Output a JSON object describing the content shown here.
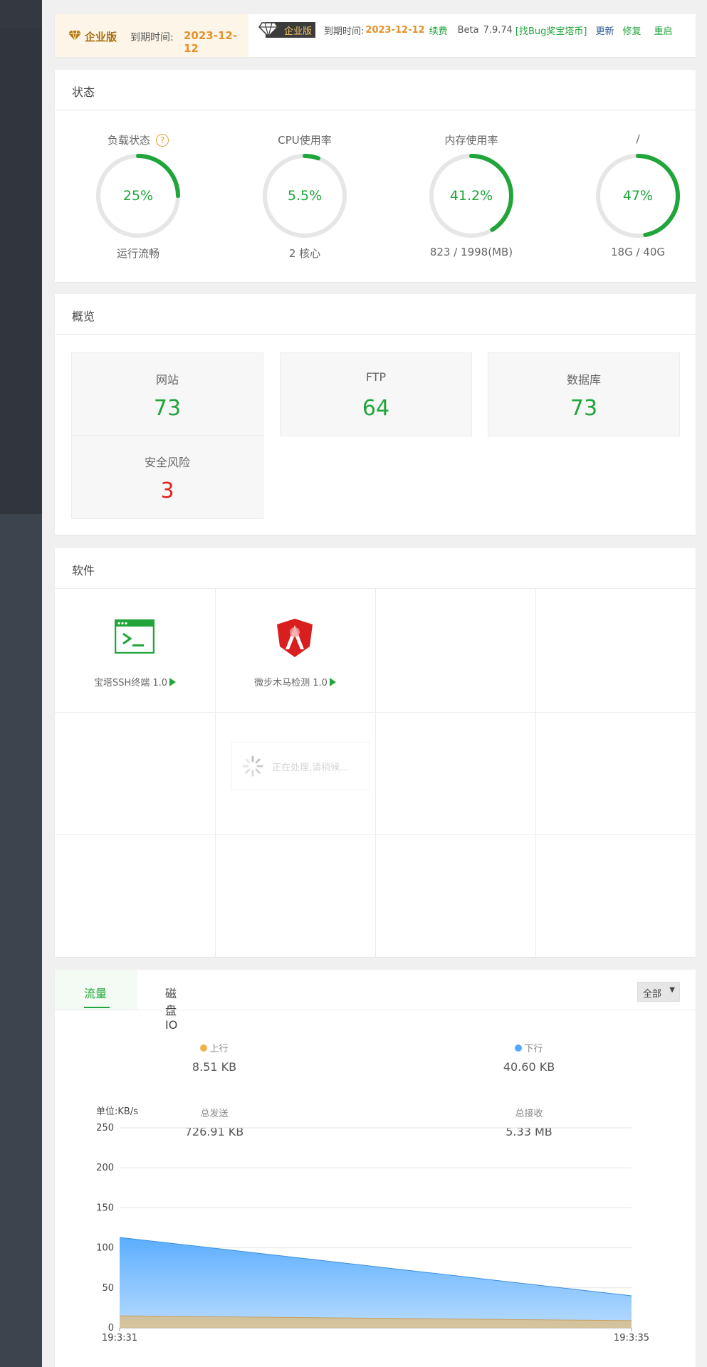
{
  "topbar": {
    "edition_label": "企业版",
    "expire_label": "到期时间:",
    "expire_date": "2023-12-12",
    "pill_label": "企业版",
    "expire_label_2": "到期时间:",
    "expire_date_2": "2023-12-12",
    "renew": "续费",
    "beta": "Beta",
    "version": "7.9.74",
    "bug_bounty": "[找Bug奖宝塔币]",
    "update": "更新",
    "repair": "修复",
    "restart": "重启",
    "colors": {
      "gold": "#a86f0d",
      "orange": "#e5902a",
      "green": "#20a53a"
    }
  },
  "status": {
    "title": "状态",
    "gauges": [
      {
        "name": "负载状态",
        "value": "25%",
        "fraction": 0.25,
        "sub": "运行流畅",
        "has_help": true
      },
      {
        "name": "CPU使用率",
        "value": "5.5%",
        "fraction": 0.055,
        "sub": "2 核心",
        "has_help": false
      },
      {
        "name": "内存使用率",
        "value": "41.2%",
        "fraction": 0.412,
        "sub": "823 / 1998(MB)",
        "has_help": false
      },
      {
        "name": "/",
        "value": "47%",
        "fraction": 0.47,
        "sub": "18G / 40G",
        "has_help": false
      }
    ],
    "gauge_color": "#20a53a",
    "track_color": "#e6e6e6"
  },
  "overview": {
    "title": "概览",
    "items": [
      {
        "label": "网站",
        "value": "73",
        "alert": false
      },
      {
        "label": "FTP",
        "value": "64",
        "alert": false
      },
      {
        "label": "数据库",
        "value": "73",
        "alert": false
      },
      {
        "label": "安全风险",
        "value": "3",
        "alert": true
      }
    ]
  },
  "software": {
    "title": "软件",
    "items": [
      {
        "name": "宝塔SSH终端 1.0",
        "icon": "terminal-icon"
      },
      {
        "name": "微步木马检测 1.0",
        "icon": "shield-icon"
      }
    ],
    "loading_text": "正在处理,请稍候..."
  },
  "traffic": {
    "tabs": [
      "流量",
      "磁盘IO"
    ],
    "active_tab": "流量",
    "select_value": "全部",
    "up_label": "上行",
    "up_value": "8.51 KB",
    "down_label": "下行",
    "down_value": "40.60 KB",
    "sent_label": "总发送",
    "sent_value": "726.91 KB",
    "recv_label": "总接收",
    "recv_value": "5.33 MB",
    "up_color": "#f0b14a",
    "down_color": "#52a9ff"
  },
  "chart_data": {
    "type": "area",
    "ylabel": "单位:KB/s",
    "ylim": [
      0,
      250
    ],
    "yticks": [
      0,
      50,
      100,
      150,
      200,
      250
    ],
    "x": [
      "19:3:31",
      "19:3:35"
    ],
    "series": [
      {
        "name": "下行",
        "values": [
          113,
          40
        ],
        "color": "#52a9ff"
      },
      {
        "name": "上行",
        "values": [
          15,
          9
        ],
        "color": "#f0b14a"
      }
    ],
    "grid": true
  }
}
